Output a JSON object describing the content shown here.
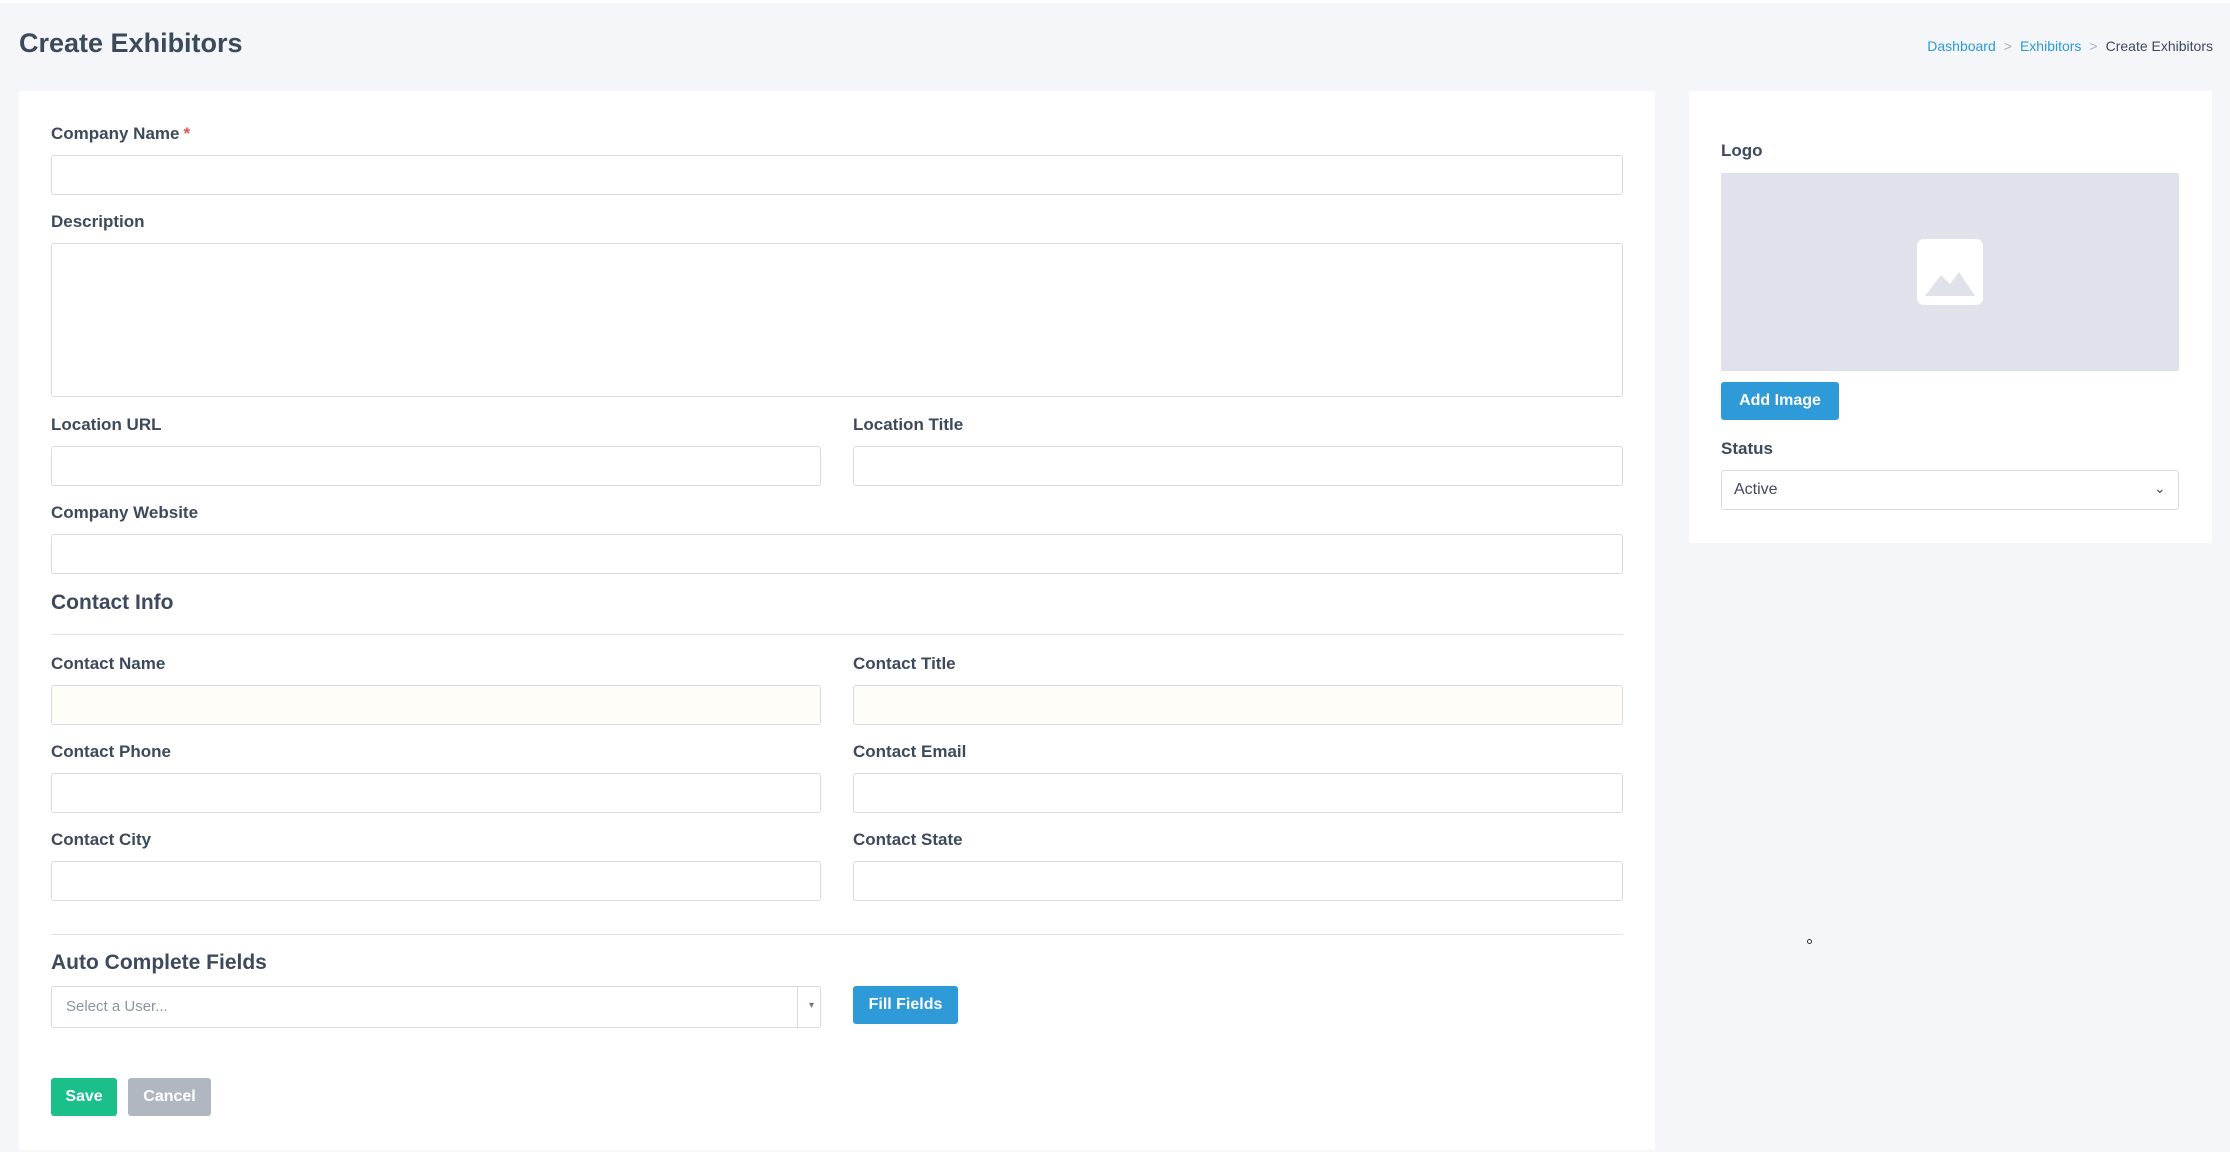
{
  "header": {
    "title": "Create Exhibitors",
    "breadcrumb": [
      "Dashboard",
      "Exhibitors",
      "Create Exhibitors"
    ],
    "breadcrumb_separator": ">"
  },
  "form": {
    "company_name": {
      "label": "Company Name",
      "required_mark": "*",
      "value": ""
    },
    "description": {
      "label": "Description",
      "value": ""
    },
    "location_url": {
      "label": "Location URL",
      "value": ""
    },
    "location_title": {
      "label": "Location Title",
      "value": ""
    },
    "company_website": {
      "label": "Company Website",
      "value": ""
    },
    "contact_section_title": "Contact Info",
    "contact_name": {
      "label": "Contact Name",
      "value": ""
    },
    "contact_title": {
      "label": "Contact Title",
      "value": ""
    },
    "contact_phone": {
      "label": "Contact Phone",
      "value": ""
    },
    "contact_email": {
      "label": "Contact Email",
      "value": ""
    },
    "contact_city": {
      "label": "Contact City",
      "value": ""
    },
    "contact_state": {
      "label": "Contact State",
      "value": ""
    },
    "autocomplete_section_title": "Auto Complete Fields",
    "user_select": {
      "placeholder": "Select a User...",
      "arrow": "▾"
    },
    "fill_fields_label": "Fill Fields",
    "save_label": "Save",
    "cancel_label": "Cancel"
  },
  "sidebar": {
    "logo_label": "Logo",
    "logo_placeholder_icon": "image-icon",
    "add_image_label": "Add Image",
    "status_label": "Status",
    "status_value": "Active",
    "status_chevron": "⌄"
  },
  "colors": {
    "background": "#f4f6fa",
    "primary": "#2e9ad8",
    "success": "#1bbf8a",
    "secondary": "#b1b7c1",
    "required": "#e55353"
  }
}
